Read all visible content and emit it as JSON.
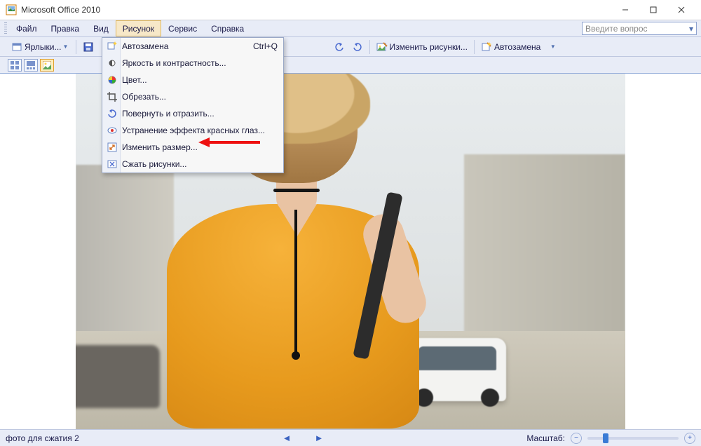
{
  "titlebar": {
    "app_title": "Microsoft Office 2010"
  },
  "menubar": {
    "items": [
      "Файл",
      "Правка",
      "Вид",
      "Рисунок",
      "Сервис",
      "Справка"
    ],
    "active_index": 3,
    "ask_placeholder": "Введите вопрос"
  },
  "toolbar": {
    "shortcuts_label": "Ярлыки...",
    "edit_pics_label": "Изменить рисунки...",
    "autocorr_label": "Автозамена"
  },
  "dropdown": {
    "items": [
      {
        "label": "Автозамена",
        "shortcut": "Ctrl+Q",
        "icon": "autofix"
      },
      {
        "label": "Яркость и контрастность...",
        "icon": "brightness"
      },
      {
        "label": "Цвет...",
        "icon": "color"
      },
      {
        "label": "Обрезать...",
        "icon": "crop"
      },
      {
        "label": "Повернуть и отразить...",
        "icon": "rotate"
      },
      {
        "label": "Устранение эффекта красных глаз...",
        "icon": "redeye"
      },
      {
        "label": "Изменить размер...",
        "icon": "resize"
      },
      {
        "label": "Сжать рисунки...",
        "icon": "compress"
      }
    ],
    "highlighted_index": 6
  },
  "statusbar": {
    "filename": "фото для сжатия 2",
    "zoom_label": "Масштаб:"
  }
}
